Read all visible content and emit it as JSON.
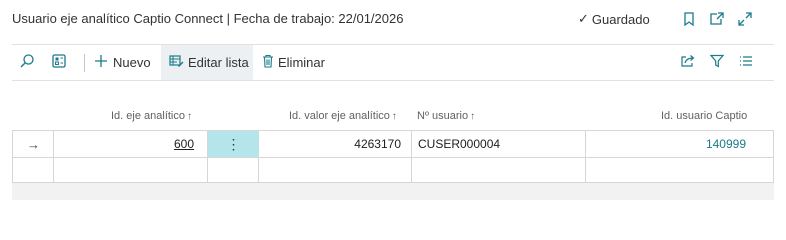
{
  "header": {
    "title": "Usuario eje analítico Captio Connect | Fecha de trabajo: 22/01/2026",
    "status": "Guardado"
  },
  "toolbar": {
    "new_label": "Nuevo",
    "edit_list_label": "Editar lista",
    "delete_label": "Eliminar"
  },
  "table": {
    "columns": [
      {
        "label": "Id. eje analítico",
        "sort": "↑"
      },
      {
        "label": "Id. valor eje analítico",
        "sort": "↑"
      },
      {
        "label": "Nº usuario",
        "sort": "↑"
      },
      {
        "label": "Id. usuario Captio",
        "sort": ""
      }
    ],
    "rows": [
      {
        "indicator": "→",
        "id_eje": "600",
        "menu": "⋮",
        "id_valor": "4263170",
        "n_usuario": "CUSER000004",
        "id_captio": "140999"
      }
    ]
  },
  "colors": {
    "accent": "#1a7b8a",
    "selected_cell": "#b4e5eb",
    "active_button": "#edf0f2"
  }
}
